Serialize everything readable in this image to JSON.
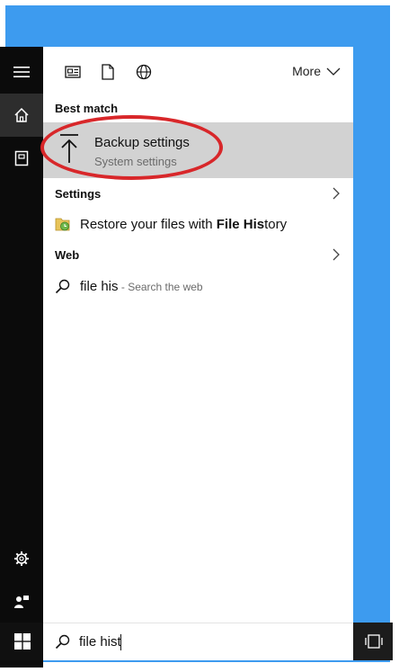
{
  "colors": {
    "desktop": "#3d9bef",
    "rail": "#0b0b0b",
    "selected_row": "#d2d2d2",
    "annotation_oval": "#d8272a"
  },
  "toolbar": {
    "icons": [
      "news-icon",
      "document-icon",
      "globe-icon"
    ],
    "more_label": "More"
  },
  "sections": {
    "best_match": "Best match",
    "settings": "Settings",
    "web": "Web"
  },
  "best_match": {
    "title": "Backup settings",
    "subtitle": "System settings",
    "icon": "upload-arrow-icon"
  },
  "settings_result": {
    "prefix": "Restore your files with ",
    "bold": "File His",
    "suffix": "tory",
    "icon": "file-history-icon"
  },
  "web_result": {
    "query": "file his",
    "hint": " - Search the web",
    "icon": "search-icon"
  },
  "search": {
    "value": "file hist"
  },
  "rail": {
    "icons": [
      "hamburger-icon",
      "home-icon",
      "notebook-icon",
      "gear-icon",
      "feedback-icon",
      "windows-logo-icon"
    ]
  },
  "taskbar": {
    "right_icon": "task-view-icon"
  }
}
